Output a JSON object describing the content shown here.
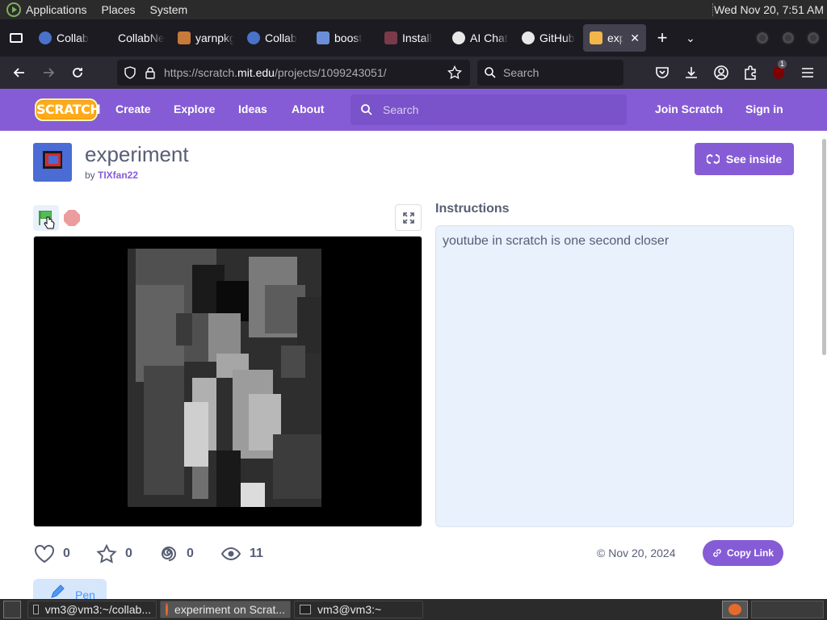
{
  "gnome_panel": {
    "menus": [
      "Applications",
      "Places",
      "System"
    ],
    "clock": "Wed Nov 20,  7:51 AM"
  },
  "browser": {
    "tabs": [
      {
        "label": "Collab",
        "icon_color": "#4a72c9"
      },
      {
        "label": "CollabNet",
        "icon_color": "#1c1b22"
      },
      {
        "label": "yarnpkg",
        "icon_color": "#c77a3a"
      },
      {
        "label": "Collab",
        "icon_color": "#4a72c9"
      },
      {
        "label": "boost",
        "icon_color": "#6a8fd8"
      },
      {
        "label": "Install",
        "icon_color": "#7a3a4a"
      },
      {
        "label": "AI Chat",
        "icon_color": "#e8e8e8"
      },
      {
        "label": "GitHub",
        "icon_color": "#e8e8e8"
      },
      {
        "label": "experiment",
        "icon_color": "#f2b54a",
        "active": true
      }
    ],
    "url_host": "https://scratch.",
    "url_domain": "mit.edu",
    "url_path": "/projects/1099243051/",
    "search_placeholder": "Search",
    "notification_count": "1"
  },
  "scratch": {
    "logo_text": "SCRATCH",
    "nav": [
      "Create",
      "Explore",
      "Ideas",
      "About"
    ],
    "search_placeholder": "Search",
    "join": "Join Scratch",
    "signin": "Sign in",
    "accent": "#855cd6"
  },
  "project": {
    "title": "experiment",
    "by_prefix": "by ",
    "author": "TIXfan22",
    "see_inside": "See inside",
    "instructions_title": "Instructions",
    "instructions": "youtube in scratch is one second closer",
    "loves": "0",
    "favorites": "0",
    "remixes": "0",
    "views": "11",
    "date": "Nov 20, 2024",
    "copy_link": "Copy Link",
    "extension": "Pen"
  },
  "taskbar": {
    "items": [
      "vm3@vm3:~/collab...",
      "experiment on Scrat...",
      "vm3@vm3:~"
    ]
  }
}
